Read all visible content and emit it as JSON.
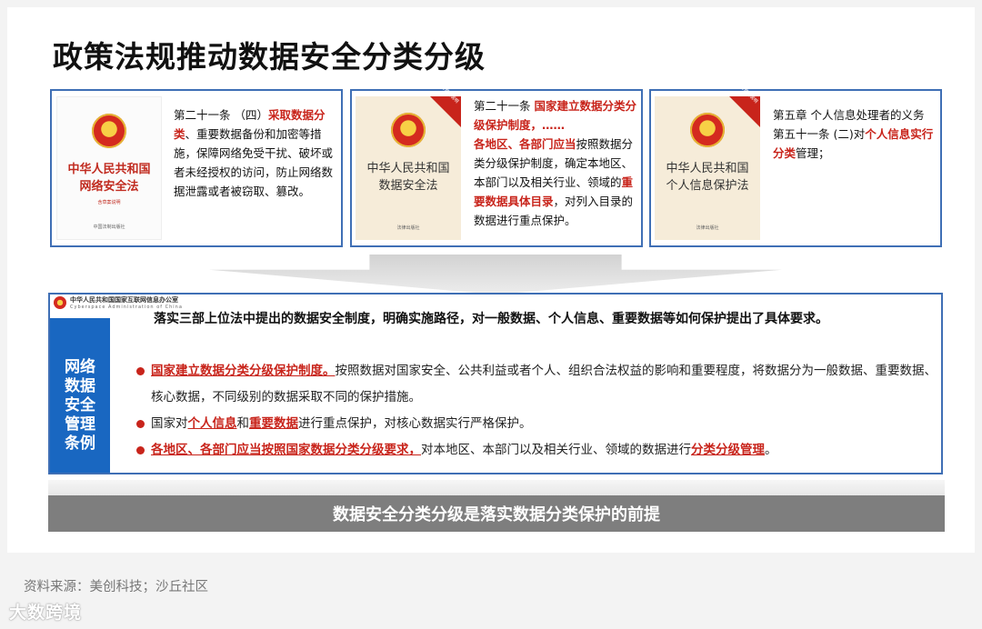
{
  "title": "政策法规推动数据安全分类分级",
  "laws": [
    {
      "cover_title_line1": "中华人民共和国",
      "cover_title_line2": "网络安全法",
      "cover_sub": "含草案说明",
      "cover_pub": "中国法制出版社",
      "text": {
        "p1": "第二十一条 （四）",
        "p1_red": "采取数据分类",
        "p2": "、重要数据备份和加密等措施，保障网络免受干扰、破坏或者未经授权的访问，防止网络数据泄露或者被窃取、篡改。"
      }
    },
    {
      "ribbon": "附草案说明",
      "cover_title_line1": "中华人民共和国",
      "cover_title_line2": "数据安全法",
      "cover_pub": "法律出版社",
      "text": {
        "p1": "第二十一条 ",
        "p1_red": "国家建立数据分类分级保护制度，……",
        "p2_red": "各地区、各部门应当",
        "p2": "按照数据分类分级保护制度，确定本地区、本部门以及相关行业、领域的",
        "p3_red": "重要数据具体目录",
        "p3": "，对列入目录的数据进行重点保护。"
      }
    },
    {
      "ribbon": "附草案说明",
      "cover_title_line1": "中华人民共和国",
      "cover_title_line2": "个人信息保护法",
      "cover_pub": "法律出版社",
      "text": {
        "p1": "第五章 个人信息处理者的义务",
        "p2": "第五十一条 (二)对",
        "p2_red": "个人信息实行分类",
        "p3": "管理；"
      }
    }
  ],
  "regulation": {
    "org_cn": "中华人民共和国国家互联网信息办公室",
    "org_en": "Cyberspace Administration of China",
    "side_label": [
      "网络",
      "数据",
      "安全",
      "管理",
      "条例"
    ],
    "intro": "落实三部上位法中提出的数据安全制度，明确实施路径，对一般数据、个人信息、重要数据等如何保护提出了具体要求。",
    "b1_red": "国家建立数据分类分级保护制度。",
    "b1": "按照数据对国家安全、公共利益或者个人、组织合法权益的影响和重要程度，将数据分为一般数据、重要数据、核心数据，不同级别的数据采取不同的保护措施。",
    "b2_a": "国家对",
    "b2_red1": "个人信息",
    "b2_b": "和",
    "b2_red2": "重要数据",
    "b2_c": "进行重点保护，对核心数据实行严格保护。",
    "b3_red": "各地区、各部门应当按照国家数据分类分级要求，",
    "b3": "对本地区、本部门以及相关行业、领域的数据进行",
    "b3_red2": "分类分级管理",
    "b3_end": "。"
  },
  "conclusion": "数据安全分类分级是落实数据分类保护的前提",
  "source": "资料来源：美创科技；沙丘社区",
  "watermark": "大数跨境"
}
